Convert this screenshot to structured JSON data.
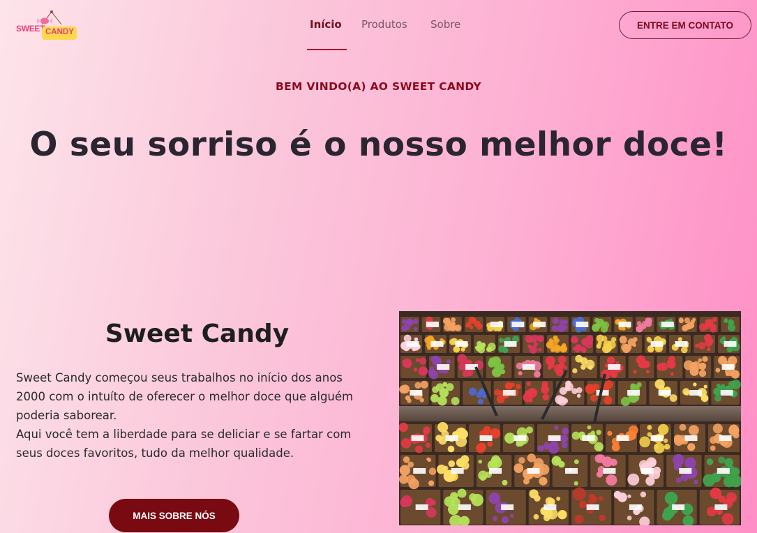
{
  "brand": {
    "logo_word1": "SWEET",
    "logo_word2": "CANDY",
    "primary": "#7a0a12",
    "accent": "#e8407a"
  },
  "nav": {
    "items": [
      {
        "label": "Início",
        "active": true
      },
      {
        "label": "Produtos",
        "active": false
      },
      {
        "label": "Sobre",
        "active": false
      }
    ]
  },
  "header": {
    "contact_label": "ENTRE EM CONTATO"
  },
  "hero": {
    "welcome": "BEM VINDO(A) AO SWEET CANDY",
    "headline": "O seu sorriso é o nosso melhor doce!"
  },
  "about": {
    "title": "Sweet Candy",
    "paragraph1": "Sweet Candy começou seus trabalhos no início dos anos 2000 com o intuíto de oferecer o melhor doce que alguém poderia saborear.",
    "paragraph2": "Aqui você tem a liberdade para se deliciar e se fartar com seus doces favoritos, tudo da melhor qualidade.",
    "button_label": "MAIS SOBRE NÓS"
  },
  "photo": {
    "subject": "candy-market-stall-photo"
  }
}
